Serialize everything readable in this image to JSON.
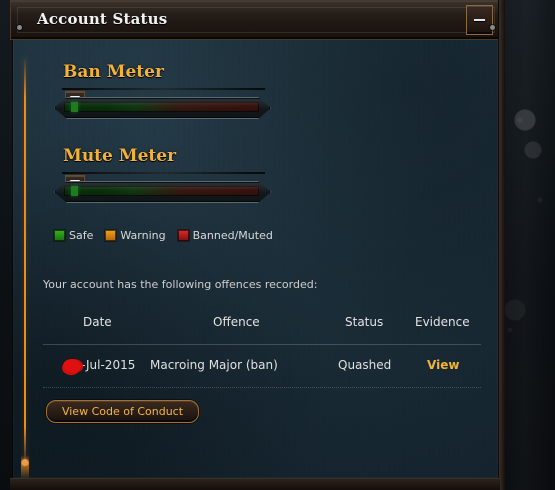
{
  "panel": {
    "title": "Account Status",
    "minimize_icon": "minus-icon"
  },
  "meters": {
    "ban_title": "Ban Meter",
    "mute_title": "Mute Meter"
  },
  "legend": [
    {
      "label": "Safe",
      "color": "#35b51c"
    },
    {
      "label": "Warning",
      "color": "#f1a61b"
    },
    {
      "label": "Banned/Muted",
      "color": "#e12a2a"
    }
  ],
  "offences": {
    "intro": "Your account has the following offences recorded:",
    "headers": {
      "date": "Date",
      "offence": "Offence",
      "status": "Status",
      "evidence": "Evidence"
    },
    "rows": [
      {
        "date_suffix": "-Jul-2015",
        "offence": "Macroing Major (ban)",
        "status": "Quashed",
        "evidence_link": "View"
      }
    ]
  },
  "buttons": {
    "code_of_conduct": "View Code of Conduct"
  },
  "colors": {
    "accent": "#f2b23a",
    "rail": "#f08a1a"
  }
}
